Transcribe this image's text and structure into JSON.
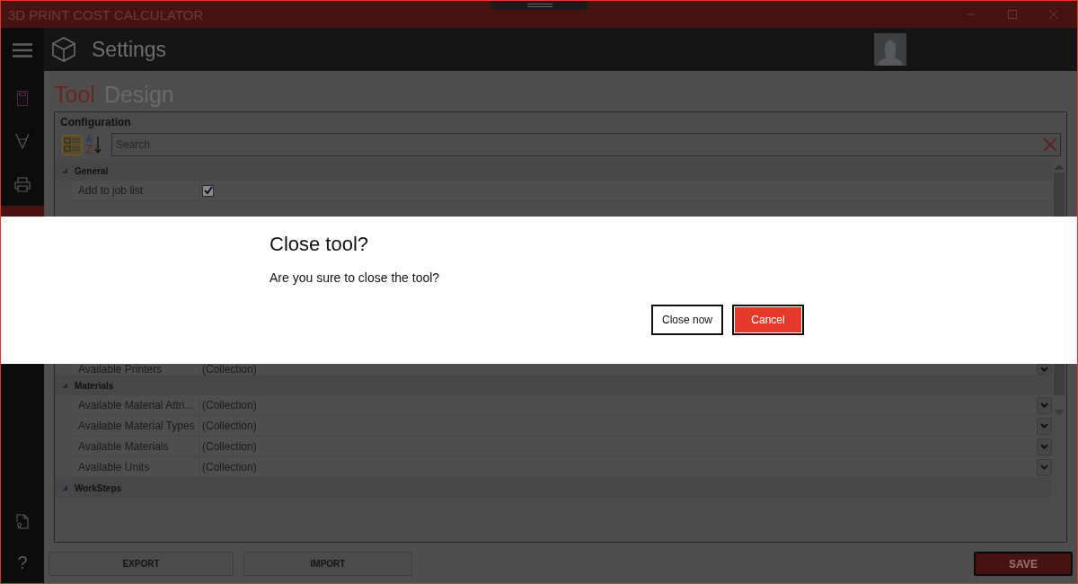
{
  "window": {
    "title": "3D PRINT COST CALCULATOR"
  },
  "sidebar": {
    "items": [
      {
        "kind": "calculator",
        "selected": false
      },
      {
        "kind": "pen",
        "selected": false
      },
      {
        "kind": "printer",
        "selected": false
      },
      {
        "kind": "hidden",
        "selected": true
      }
    ],
    "bottom": [
      {
        "kind": "license"
      },
      {
        "kind": "help",
        "label": "?"
      }
    ]
  },
  "header": {
    "title": "Settings"
  },
  "tabs": [
    {
      "label": "Tool",
      "selected": true
    },
    {
      "label": "Design",
      "selected": false
    }
  ],
  "configuration": {
    "title": "Configuration",
    "search": {
      "placeholder": "Search"
    },
    "groups": [
      {
        "title": "General",
        "expanded": true,
        "rows": [
          {
            "name": "Add to job list",
            "kind": "checkbox",
            "checked": true
          }
        ]
      },
      {
        "rows": [
          {
            "name": "Available Printers",
            "kind": "collection",
            "value": "(Collection)"
          }
        ]
      },
      {
        "title": "Materials",
        "expanded": true,
        "rows": [
          {
            "name": "Available Material Attri...",
            "kind": "collection",
            "value": "(Collection)"
          },
          {
            "name": "Available Material Types",
            "kind": "collection",
            "value": "(Collection)"
          },
          {
            "name": "Available Materials",
            "kind": "collection",
            "value": "(Collection)"
          },
          {
            "name": "Available Units",
            "kind": "collection",
            "value": "(Collection)"
          }
        ]
      },
      {
        "title": "WorkSteps",
        "expanded": true
      }
    ]
  },
  "buttons": [
    {
      "label": "EXPORT",
      "kind": "plain"
    },
    {
      "label": "IMPORT",
      "kind": "plain"
    },
    {
      "label": "SAVE",
      "kind": "primary"
    }
  ],
  "dialog": {
    "title": "Close tool?",
    "message": "Are you sure to close the tool?",
    "buttons": [
      {
        "label": "Close now",
        "kind": "secondary"
      },
      {
        "label": "Cancel",
        "kind": "primary"
      }
    ]
  }
}
